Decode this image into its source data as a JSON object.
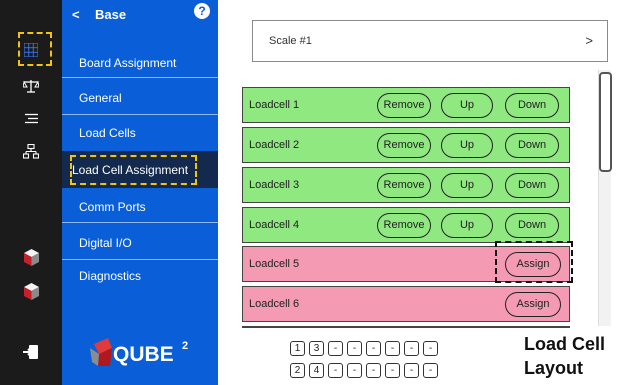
{
  "nav": {
    "back_glyph": "<",
    "title": "Base",
    "help_glyph": "?",
    "items": [
      {
        "label": "Board Assignment"
      },
      {
        "label": "General"
      },
      {
        "label": "Load Cells"
      },
      {
        "label": "Load Cell Assignment"
      },
      {
        "label": "Comm Ports"
      },
      {
        "label": "Digital I/O"
      },
      {
        "label": "Diagnostics"
      }
    ]
  },
  "logo_text": "QUBE",
  "logo_superscript": "2",
  "scale": {
    "label": "Scale #1",
    "chevron": ">"
  },
  "loadcells": [
    {
      "name": "Loadcell 1",
      "state": "assigned",
      "actions": [
        "Remove",
        "Up",
        "Down"
      ]
    },
    {
      "name": "Loadcell 2",
      "state": "assigned",
      "actions": [
        "Remove",
        "Up",
        "Down"
      ]
    },
    {
      "name": "Loadcell 3",
      "state": "assigned",
      "actions": [
        "Remove",
        "Up",
        "Down"
      ]
    },
    {
      "name": "Loadcell 4",
      "state": "assigned",
      "actions": [
        "Remove",
        "Up",
        "Down"
      ]
    },
    {
      "name": "Loadcell 5",
      "state": "unassigned",
      "actions": [
        "Assign"
      ]
    },
    {
      "name": "Loadcell 6",
      "state": "unassigned",
      "actions": [
        "Assign"
      ]
    }
  ],
  "layout": {
    "row1": [
      "1",
      "3",
      "-",
      "-",
      "-",
      "-",
      "-",
      "-"
    ],
    "row2": [
      "2",
      "4",
      "-",
      "-",
      "-",
      "-",
      "-",
      "-"
    ],
    "caption_line1": "Load Cell",
    "caption_line2": "Layout"
  },
  "colors": {
    "nav_bg": "#0a5fd9",
    "nav_active": "#13294d",
    "assigned": "#8fe880",
    "unassigned": "#f49ab3",
    "highlight": "#f1c40f"
  }
}
